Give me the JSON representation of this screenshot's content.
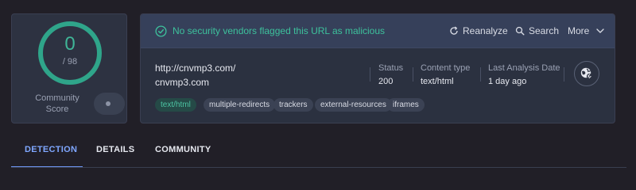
{
  "score": {
    "value": "0",
    "total": "/ 98",
    "label": "Community Score"
  },
  "banner": {
    "message": "No security vendors flagged this URL as malicious"
  },
  "actions": {
    "reanalyze": "Reanalyze",
    "search": "Search",
    "more": "More"
  },
  "url": {
    "full": "http://cnvmp3.com/",
    "domain": "cnvmp3.com"
  },
  "meta": {
    "status_label": "Status",
    "status_value": "200",
    "content_type_label": "Content type",
    "content_type_value": "text/html",
    "last_analysis_label": "Last Analysis Date",
    "last_analysis_value": "1 day ago"
  },
  "tags": [
    "text/html",
    "multiple-redirects",
    "trackers",
    "external-resources",
    "iframes"
  ],
  "tabs": [
    "DETECTION",
    "DETAILS",
    "COMMUNITY"
  ],
  "colors": {
    "accent": "#3fb597",
    "tab_active": "#7fa7ff",
    "background": "#211f27"
  },
  "icons": [
    "check-circle-icon",
    "reanalyze-icon",
    "search-icon",
    "chevron-down-icon",
    "globe-link-icon"
  ]
}
